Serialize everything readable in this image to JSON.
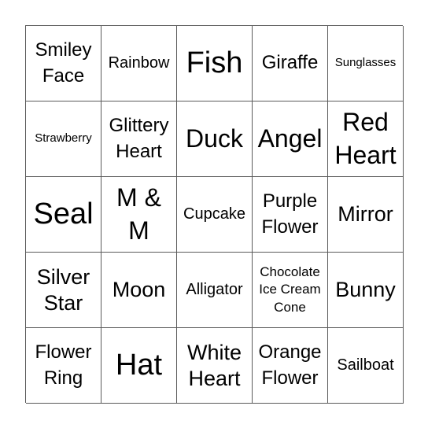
{
  "bingo": {
    "cells": [
      [
        "Smiley Face",
        "Rainbow",
        "Fish",
        "Giraffe",
        "Sunglasses"
      ],
      [
        "Strawberry",
        "Glittery Heart",
        "Duck",
        "Angel",
        "Red Heart"
      ],
      [
        "Seal",
        "M & M",
        "Cupcake",
        "Purple Flower",
        "Mirror"
      ],
      [
        "Silver Star",
        "Moon",
        "Alligator",
        "Chocolate Ice Cream Cone",
        "Bunny"
      ],
      [
        "Flower Ring",
        "Hat",
        "White Heart",
        "Orange Flower",
        "Sailboat"
      ]
    ]
  }
}
